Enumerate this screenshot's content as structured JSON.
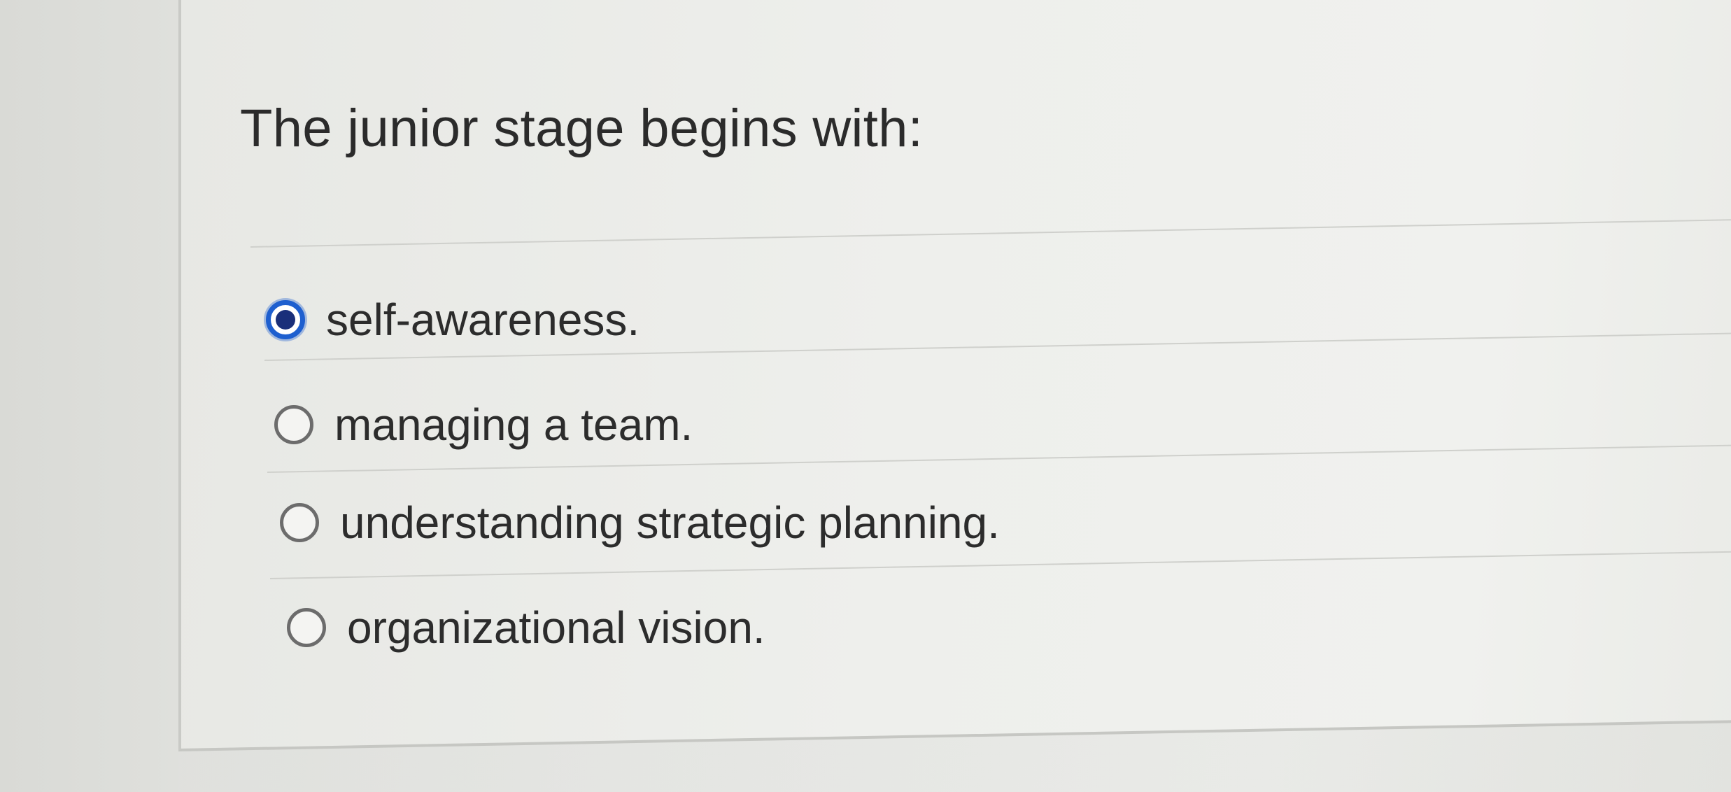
{
  "question": {
    "text": "The junior stage begins with:"
  },
  "options": [
    {
      "label": "self-awareness.",
      "selected": true
    },
    {
      "label": "managing a team.",
      "selected": false
    },
    {
      "label": "understanding strategic planning.",
      "selected": false
    },
    {
      "label": "organizational vision.",
      "selected": false
    }
  ],
  "colors": {
    "selected_radio_ring": "#1e5fcf",
    "selected_radio_dot": "#1a2f7a",
    "text": "#2b2b2b"
  },
  "icons": {
    "selected": "radio-checked-icon",
    "unselected": "radio-unchecked-icon"
  }
}
